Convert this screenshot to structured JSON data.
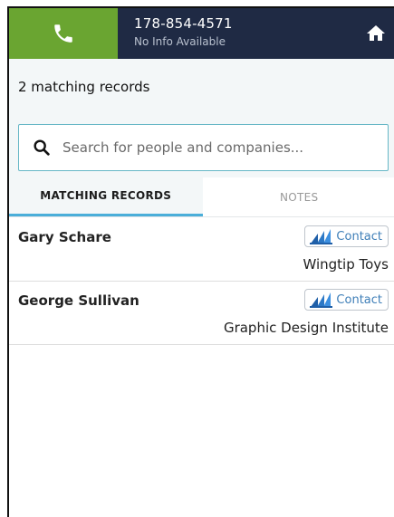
{
  "header": {
    "phone_number": "178-854-4571",
    "phone_info": "No Info Available",
    "call_icon": "phone-icon",
    "home_icon": "home-icon",
    "colors": {
      "header_bg": "#1f2a44",
      "call_bg": "#6aa531"
    }
  },
  "status": {
    "text": "2 matching records"
  },
  "search": {
    "placeholder": "Search for people and companies...",
    "value": ""
  },
  "tabs": [
    {
      "label": "MATCHING RECORDS",
      "active": true
    },
    {
      "label": "NOTES",
      "active": false
    }
  ],
  "records": [
    {
      "name": "Gary Schare",
      "type_label": "Contact",
      "company": "Wingtip Toys"
    },
    {
      "name": "George Sullivan",
      "type_label": "Contact",
      "company": "Graphic Design Institute"
    }
  ]
}
